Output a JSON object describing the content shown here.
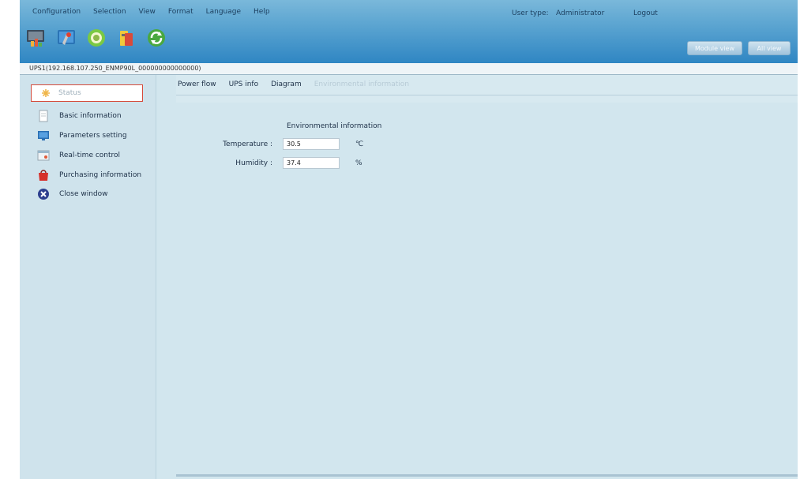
{
  "menubar": {
    "items": [
      "Configuration",
      "Selection",
      "View",
      "Format",
      "Language",
      "Help"
    ]
  },
  "user": {
    "type_label": "User type:",
    "type_value": "Administrator",
    "logout_label": "Logout"
  },
  "top_buttons": {
    "left_label": "Module view",
    "right_label": "All view"
  },
  "toolbar": {
    "icons": [
      "monitor-chart-icon",
      "config-tools-icon",
      "target-ring-icon",
      "ups-device-icon",
      "refresh-icon"
    ]
  },
  "device_title": "UPS1(192.168.107.250_ENMP90L_000000000000000)",
  "sidebar": {
    "status_label": "Status",
    "items": [
      {
        "label": "Basic information",
        "icon": "document-icon"
      },
      {
        "label": "Parameters setting",
        "icon": "monitor-icon"
      },
      {
        "label": "Real-time control",
        "icon": "window-control-icon"
      },
      {
        "label": "Purchasing information",
        "icon": "shopping-bag-icon"
      },
      {
        "label": "Close window",
        "icon": "close-circle-icon"
      }
    ]
  },
  "tabs": [
    {
      "label": "Power flow",
      "enabled": true
    },
    {
      "label": "UPS info",
      "enabled": true
    },
    {
      "label": "Diagram",
      "enabled": true
    },
    {
      "label": "Environmental information",
      "enabled": false
    }
  ],
  "environment": {
    "section_title": "Environmental information",
    "temperature_label": "Temperature :",
    "temperature_value": "30.5",
    "temperature_unit": "℃",
    "humidity_label": "Humidity :",
    "humidity_value": "37.4",
    "humidity_unit": "%"
  },
  "colors": {
    "banner": "#2f86c3",
    "panel": "#d2e6ee",
    "selected_border": "#d64b3b"
  }
}
